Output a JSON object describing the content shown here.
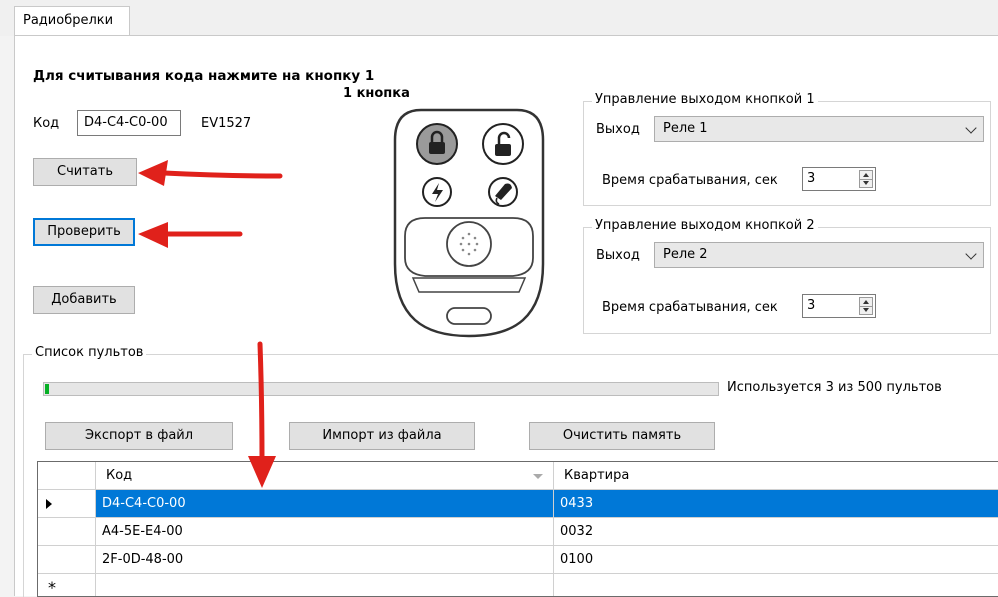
{
  "tab": {
    "label": "Радиобрелки"
  },
  "read_section": {
    "instruction": "Для считывания кода нажмите на кнопку 1",
    "code_label": "Код",
    "code_value": "D4-C4-C0-00",
    "protocol": "EV1527",
    "read_button": "Считать",
    "check_button": "Проверить",
    "add_button": "Добавить"
  },
  "remote_image": {
    "caption": "1 кнопка"
  },
  "output1": {
    "title": "Управление выходом кнопкой 1",
    "output_label": "Выход",
    "output_value": "Реле 1",
    "time_label": "Время срабатывания, сек",
    "time_value": "3"
  },
  "output2": {
    "title": "Управление выходом кнопкой 2",
    "output_label": "Выход",
    "output_value": "Реле 2",
    "time_label": "Время срабатывания, сек",
    "time_value": "3"
  },
  "list": {
    "title": "Список пультов",
    "usage_text": "Используется 3 из 500 пультов",
    "usage_fraction": 0.006,
    "export_button": "Экспорт в файл",
    "import_button": "Импорт из файла",
    "clear_button": "Очистить память",
    "columns": [
      "Код",
      "Квартира"
    ],
    "rows": [
      {
        "code": "D4-C4-C0-00",
        "apartment": "0433"
      },
      {
        "code": "A4-5E-E4-00",
        "apartment": "0032"
      },
      {
        "code": "2F-0D-48-00",
        "apartment": "0100"
      }
    ],
    "new_row_marker": "*"
  },
  "colors": {
    "selection": "#0078d7",
    "progress": "#06b025",
    "arrow": "#e0211b"
  }
}
